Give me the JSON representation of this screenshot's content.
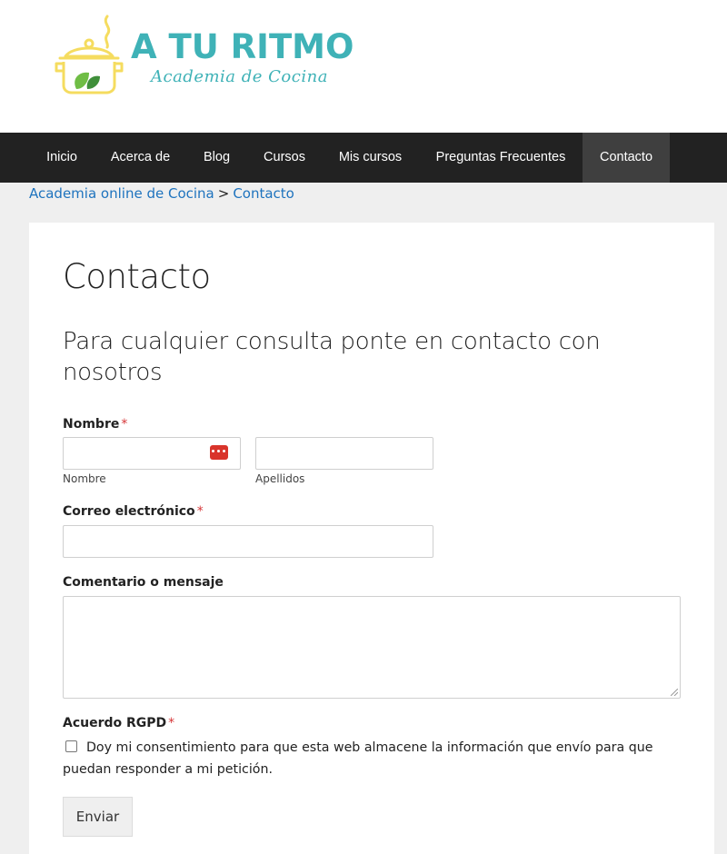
{
  "brand": {
    "title": "A TU RITMO",
    "subtitle": "Academia de Cocina",
    "colors": {
      "primary": "#3fb2b7",
      "accent": "#f5dc5f",
      "leaf": "#6fbd45"
    }
  },
  "nav": {
    "items": [
      {
        "label": "Inicio"
      },
      {
        "label": "Acerca de"
      },
      {
        "label": "Blog"
      },
      {
        "label": "Cursos"
      },
      {
        "label": "Mis cursos"
      },
      {
        "label": "Preguntas Frecuentes"
      },
      {
        "label": "Contacto",
        "active": true
      }
    ]
  },
  "breadcrumb": {
    "home": "Academia online de Cocina",
    "separator": ">",
    "current": "Contacto"
  },
  "page": {
    "title": "Contacto",
    "intro": "Para cualquier consulta ponte en contacto con nosotros"
  },
  "form": {
    "name_label": "Nombre",
    "required_mark": "*",
    "first_name_sublabel": "Nombre",
    "last_name_sublabel": "Apellidos",
    "first_name_value": "",
    "last_name_value": "",
    "email_label": "Correo electrónico",
    "email_value": "",
    "message_label": "Comentario o mensaje",
    "message_value": "",
    "gdpr_label": "Acuerdo RGPD",
    "gdpr_text": "Doy mi consentimiento para que esta web almacene la información que envío para que puedan responder a mi petición.",
    "gdpr_checked": false,
    "submit_label": "Enviar",
    "password_manager_icon": "password-manager-icon"
  }
}
